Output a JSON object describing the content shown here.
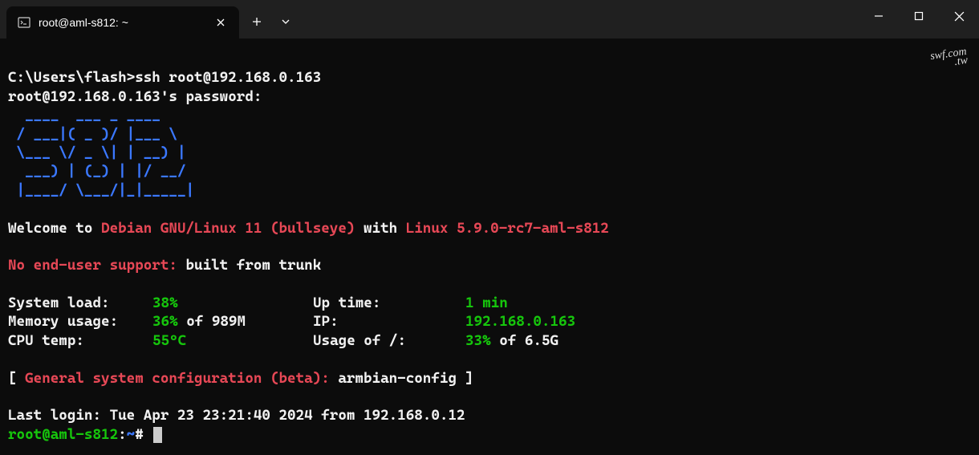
{
  "titlebar": {
    "tab_title": "root@aml-s812: ~"
  },
  "terminal": {
    "prompt_line": "C:\\Users\\flash>ssh root@192.168.0.163",
    "password_prompt": "root@192.168.0.163's password:",
    "ascii_art": [
      "  ____  ___ _ ____",
      " / ___|( _ )/ |___ \\",
      " \\___ \\/ _ \\| | __) |",
      "  ___) | (_) | |/ __/",
      " |____/ \\___/|_|_____|"
    ],
    "welcome_prefix": "Welcome to ",
    "os_name": "Debian GNU/Linux 11 (bullseye)",
    "with_text": " with ",
    "kernel": "Linux 5.9.0-rc7-aml-s812",
    "support_label": "No end-user support:",
    "support_value": " built from trunk",
    "stats": {
      "system_load_label": "System load:",
      "system_load_value": "38%",
      "uptime_label": "Up time:",
      "uptime_value": "1 min",
      "memory_label": "Memory usage:",
      "memory_value": "36%",
      "memory_of": " of 989M",
      "ip_label": "IP:",
      "ip_value": "192.168.0.163",
      "cpu_temp_label": "CPU temp:",
      "cpu_temp_value": "55°C",
      "usage_label": "Usage of /:",
      "usage_value": "33%",
      "usage_of": " of 6.5G"
    },
    "config_line_bracket_open": "[ ",
    "config_line_label": "General system configuration (beta)",
    "config_line_colon": ": ",
    "config_line_cmd": "armbian-config",
    "config_line_bracket_close": " ]",
    "last_login": "Last login: Tue Apr 23 23:21:40 2024 from 192.168.0.12",
    "shell_user_host": "root@aml-s812",
    "shell_colon": ":",
    "shell_path": "~",
    "shell_hash": "# "
  },
  "watermark": {
    "line1": "swf.com",
    "line2": ".tw"
  }
}
